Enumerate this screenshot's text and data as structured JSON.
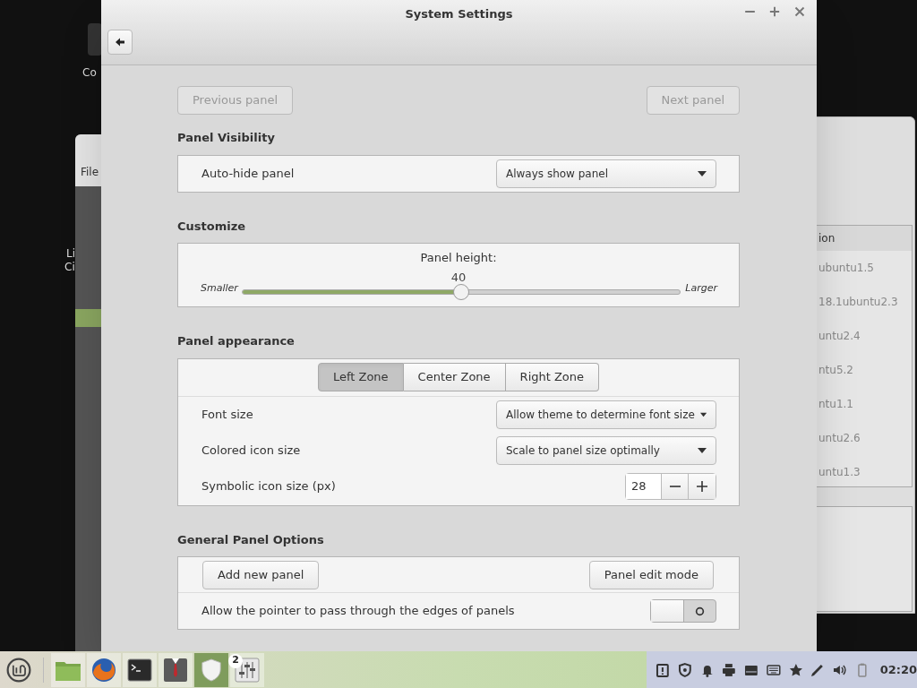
{
  "desktop": {
    "icon_label": "Co"
  },
  "file_window": {
    "menu": "File",
    "sidebar_labels": [
      "Li",
      "Ci"
    ]
  },
  "back_window": {
    "column_header": "ion",
    "rows": [
      "ubuntu1.5",
      "18.1ubuntu2.3",
      "untu2.4",
      "ntu5.2",
      "ntu1.1",
      "untu2.6",
      "untu1.3"
    ]
  },
  "window": {
    "title": "System Settings"
  },
  "nav": {
    "previous": {
      "label": "Previous panel",
      "disabled": true
    },
    "next": {
      "label": "Next panel",
      "disabled": true
    }
  },
  "sections": [
    {
      "kind": "combo",
      "title": "Panel Visibility",
      "rows": [
        {
          "label": "Auto-hide panel",
          "value": "Always show panel"
        }
      ]
    },
    {
      "kind": "slider",
      "title": "Customize",
      "label": "Panel height:",
      "reading": "40",
      "min_label": "Smaller",
      "max_label": "Larger",
      "level": 0.5
    },
    {
      "kind": "appearance",
      "title": "Panel appearance",
      "tabs": [
        {
          "label": "Left Zone",
          "selected": true
        },
        {
          "label": "Center Zone",
          "selected": false
        },
        {
          "label": "Right Zone",
          "selected": false
        }
      ],
      "rows": [
        {
          "kind": "combo",
          "label": "Font size",
          "value": "Allow theme to determine font size"
        },
        {
          "kind": "combo",
          "label": "Colored icon size",
          "value": "Scale to panel size optimally"
        },
        {
          "kind": "spin",
          "label": "Symbolic icon size (px)",
          "value": "28"
        }
      ]
    },
    {
      "kind": "options",
      "title": "General Panel Options",
      "buttons": [
        "Add new panel",
        "Panel edit mode"
      ],
      "switch": {
        "label": "Allow the pointer to pass through the edges of panels",
        "on": false
      }
    }
  ],
  "taskbar": {
    "launchers": [
      {
        "kind": "folder",
        "active": false
      },
      {
        "kind": "browser",
        "active": false
      },
      {
        "kind": "terminal",
        "active": false
      },
      {
        "kind": "suit",
        "active": false
      },
      {
        "kind": "shield",
        "active": true
      },
      {
        "kind": "mixer",
        "active": false,
        "badge": "2"
      }
    ],
    "clock": "02:20"
  }
}
